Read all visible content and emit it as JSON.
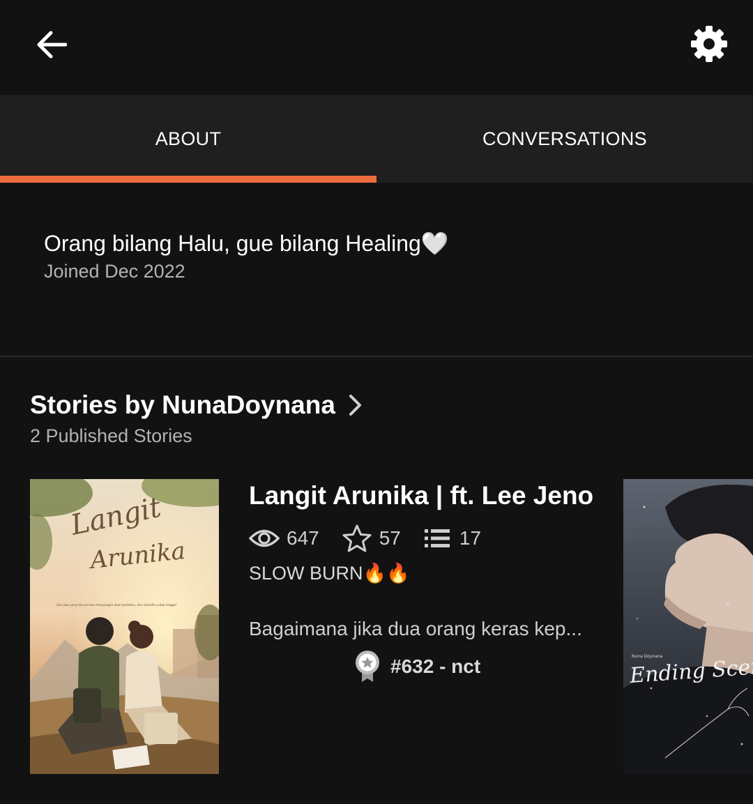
{
  "header": {
    "back_icon": "arrow-left-icon",
    "settings_icon": "gear-icon"
  },
  "tabs": [
    {
      "label": "ABOUT",
      "active": true
    },
    {
      "label": "CONVERSATIONS",
      "active": false
    }
  ],
  "accent_color": "#ed6c3c",
  "about": {
    "bio": "Orang bilang Halu, gue bilang Healing🤍",
    "joined": "Joined Dec 2022"
  },
  "stories": {
    "title": "Stories by NunaDoynana",
    "count_label": "2 Published Stories",
    "items": [
      {
        "title": "Langit Arunika | ft. Lee Jeno",
        "cover_title_line1": "Langit",
        "cover_title_line2": "Arunika",
        "cover_tagline": "dua jiwa yang tak pernah menyangka akan bertemu, lalu memilih untuk tinggal",
        "views": "647",
        "votes": "57",
        "parts": "17",
        "tag": "SLOW BURN🔥🔥",
        "description": "Bagaimana jika dua orang keras kep...",
        "rank": "#632 - nct"
      },
      {
        "cover_author": "Nuna Doynana",
        "cover_title": "Ending Scene!"
      }
    ]
  }
}
